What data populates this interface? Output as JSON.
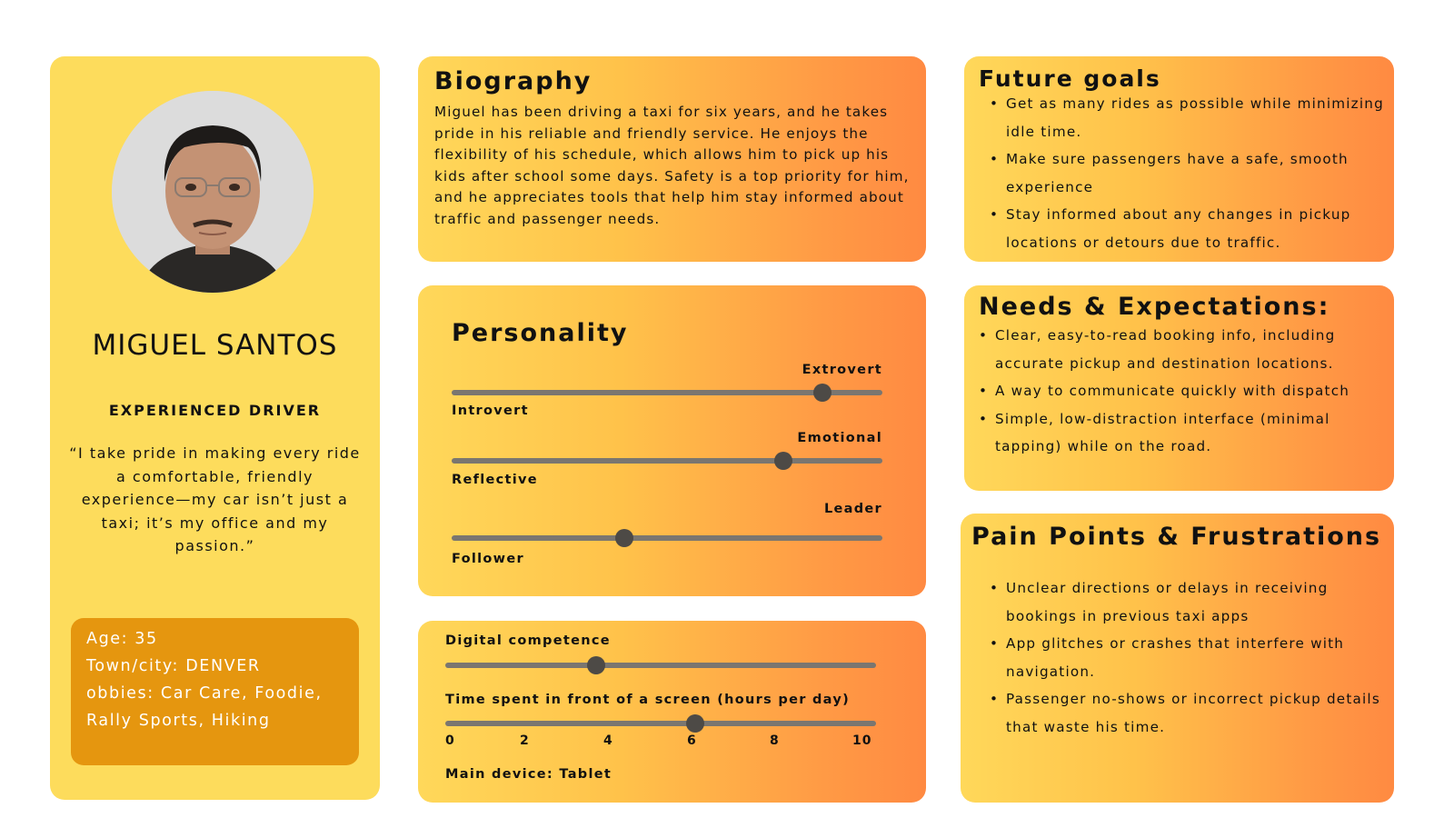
{
  "profile": {
    "name": "MIGUEL SANTOS",
    "role": "EXPERIENCED DRIVER",
    "quote": "“I take pride in making every ride a comfortable, friendly experience—my car isn’t just a taxi; it’s my office and my passion.”",
    "info": [
      "Age: 35",
      "Town/city: DENVER",
      "obbies: Car Care, Foodie,",
      "Rally Sports, Hiking"
    ]
  },
  "biography": {
    "title": "Biography",
    "text": "Miguel has been driving a taxi for six years, and he takes pride in his reliable and friendly service. He enjoys the flexibility of his schedule, which allows him to pick up his kids after school some days. Safety is a top priority for him, and he appreciates tools that help him stay informed about traffic and passenger needs."
  },
  "personality": {
    "title": "Personality",
    "traits": [
      {
        "left": "Introvert",
        "right": "Extrovert",
        "value": 0.86
      },
      {
        "left": "Reflective",
        "right": "Emotional",
        "value": 0.77
      },
      {
        "left": "Follower",
        "right": "Leader",
        "value": 0.4
      }
    ]
  },
  "digital": {
    "competence_label": "Digital competence",
    "competence_value": 0.35,
    "screen_label": "Time spent in front of a screen (hours per day)",
    "screen_value": 5.8,
    "ticks": [
      "0",
      "2",
      "4",
      "6",
      "8",
      "10"
    ],
    "device": "Main device: Tablet"
  },
  "goals": {
    "title": "Future goals",
    "items": [
      "Get as many rides as possible while minimizing idle time.",
      "Make sure passengers have a safe, smooth experience",
      "Stay informed about any changes in pickup locations or detours due to traffic."
    ]
  },
  "needs": {
    "title": "Needs & Expectations:",
    "items": [
      "Clear, easy-to-read booking info, including accurate pickup and destination locations.",
      "A way to communicate quickly with dispatch",
      "Simple, low-distraction interface (minimal tapping) while on the road."
    ]
  },
  "pain": {
    "title": "Pain Points & Frustrations",
    "items": [
      "Unclear directions or delays in receiving bookings in previous taxi apps",
      "App glitches or crashes that interfere with navigation.",
      "Passenger no-shows or incorrect pickup details that waste his time."
    ]
  }
}
